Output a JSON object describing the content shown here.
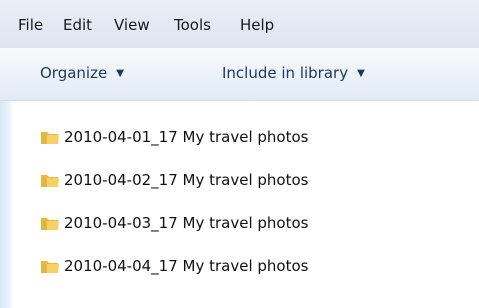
{
  "menu": {
    "items": [
      "File",
      "Edit",
      "View",
      "Tools",
      "Help"
    ]
  },
  "toolbar": {
    "organize_label": "Organize",
    "include_label": "Include in library"
  },
  "files": [
    {
      "name": "2010-04-01_17 My travel photos",
      "icon": "folder-icon"
    },
    {
      "name": "2010-04-02_17 My travel photos",
      "icon": "folder-icon"
    },
    {
      "name": "2010-04-03_17 My travel photos",
      "icon": "folder-icon"
    },
    {
      "name": "2010-04-04_17 My travel photos",
      "icon": "folder-icon"
    }
  ],
  "colors": {
    "menubar_bg": "#e3e9f3",
    "commandbar_bg": "#edf3f9",
    "command_text": "#1e395b",
    "folder_yellow": "#f1c94e"
  }
}
